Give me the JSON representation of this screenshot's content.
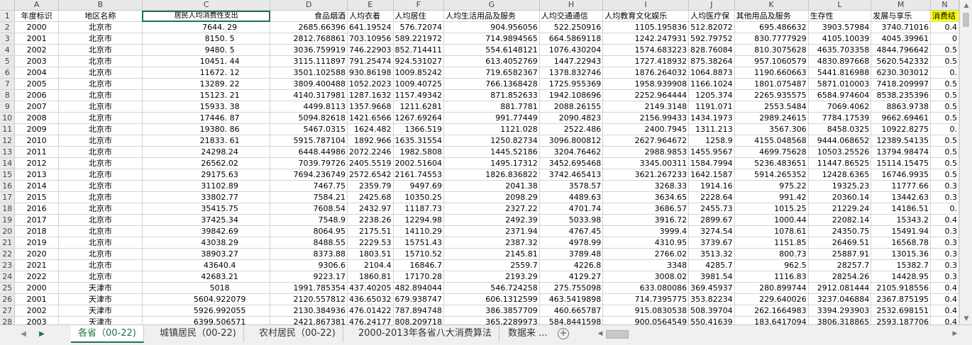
{
  "columns": [
    "A",
    "B",
    "C",
    "D",
    "E",
    "F",
    "G",
    "H",
    "I",
    "J",
    "K",
    "L",
    "M",
    "N"
  ],
  "header_row": [
    "年度标识",
    "地区名称",
    "居民人均消费性支出",
    "食品烟酒",
    "人均衣着",
    "人均居住",
    "人均生活用品及服务",
    "人均交通通信",
    "人均教育文化娱乐",
    "人均医疗保",
    "其他用品及服务",
    "生存性",
    "发展与享乐",
    "消费结"
  ],
  "rows": [
    [
      "2000",
      "北京市",
      "7644. 29",
      "2685.66396",
      "641.19524",
      "576.72074",
      "904.956056",
      "522.250916",
      "1105.195836",
      "512.82072",
      "695.486632",
      "3903.57984",
      "3740.71016",
      "0.4"
    ],
    [
      "2001",
      "北京市",
      "8150. 5",
      "2812.768861",
      "703.10956",
      "589.221972",
      "714.9894565",
      "664.5869118",
      "1242.247931",
      "592.79752",
      "830.7777929",
      "4105.10039",
      "4045.39961",
      "0"
    ],
    [
      "2002",
      "北京市",
      "9480. 5",
      "3036.759919",
      "746.22903",
      "852.714411",
      "554.6148121",
      "1076.430204",
      "1574.683223",
      "828.76084",
      "810.3075628",
      "4635.703358",
      "4844.796642",
      "0.5"
    ],
    [
      "2003",
      "北京市",
      "10451. 44",
      "3115.111897",
      "791.25474",
      "924.531027",
      "613.4052769",
      "1447.22943",
      "1727.418932",
      "875.38264",
      "957.1060579",
      "4830.897668",
      "5620.542332",
      "0.5"
    ],
    [
      "2004",
      "北京市",
      "11672. 12",
      "3501.102588",
      "930.86198",
      "1009.85242",
      "719.6582367",
      "1378.832746",
      "1876.264032",
      "1064.8873",
      "1190.660663",
      "5441.816988",
      "6230.303012",
      "0."
    ],
    [
      "2005",
      "北京市",
      "13289. 22",
      "3809.400488",
      "1052.2023",
      "1009.40725",
      "766.1368428",
      "1725.955369",
      "1958.939908",
      "1166.1024",
      "1801.075487",
      "5871.010003",
      "7418.209997",
      "0.5"
    ],
    [
      "2006",
      "北京市",
      "15123. 21",
      "4140.317981",
      "1287.1632",
      "1157.49342",
      "871.852633",
      "1942.108696",
      "2252.964444",
      "1205.374",
      "2265.935575",
      "6584.974604",
      "8538.235396",
      "0.5"
    ],
    [
      "2007",
      "北京市",
      "15933. 38",
      "4499.8113",
      "1357.9668",
      "1211.6281",
      "881.7781",
      "2088.26155",
      "2149.3148",
      "1191.071",
      "2553.5484",
      "7069.4062",
      "8863.9738",
      "0.5"
    ],
    [
      "2008",
      "北京市",
      "17446. 87",
      "5094.82618",
      "1421.6566",
      "1267.69264",
      "991.77449",
      "2090.4823",
      "2156.99433",
      "1434.1973",
      "2989.24615",
      "7784.17539",
      "9662.69461",
      "0.5"
    ],
    [
      "2009",
      "北京市",
      "19380. 86",
      "5467.0315",
      "1624.482",
      "1366.519",
      "1121.028",
      "2522.486",
      "2400.7945",
      "1311.213",
      "3567.306",
      "8458.0325",
      "10922.8275",
      "0."
    ],
    [
      "2010",
      "北京市",
      "21833. 61",
      "5915.787104",
      "1892.966",
      "1635.31554",
      "1250.82734",
      "3096.800812",
      "2627.964672",
      "1258.9",
      "4155.048568",
      "9444.068652",
      "12389.54135",
      "0.5"
    ],
    [
      "2011",
      "北京市",
      "24298.24",
      "6448.44986",
      "2072.2246",
      "1982.5808",
      "1445.52186",
      "3204.76462",
      "2988.9853",
      "1455.9567",
      "4699.75628",
      "10503.25526",
      "13794.98474",
      "0.5"
    ],
    [
      "2012",
      "北京市",
      "26562.02",
      "7039.79726",
      "2405.5519",
      "2002.51604",
      "1495.17312",
      "3452.695468",
      "3345.00311",
      "1584.7994",
      "5236.483651",
      "11447.86525",
      "15114.15475",
      "0.5"
    ],
    [
      "2013",
      "北京市",
      "29175.63",
      "7694.236749",
      "2572.6542",
      "2161.74553",
      "1826.836822",
      "3742.465413",
      "3621.267233",
      "1642.1587",
      "5914.265352",
      "12428.6365",
      "16746.9935",
      "0.5"
    ],
    [
      "2014",
      "北京市",
      "31102.89",
      "7467.75",
      "2359.79",
      "9497.69",
      "2041.38",
      "3578.57",
      "3268.33",
      "1914.16",
      "975.22",
      "19325.23",
      "11777.66",
      "0.3"
    ],
    [
      "2015",
      "北京市",
      "33802.77",
      "7584.21",
      "2425.68",
      "10350.25",
      "2098.29",
      "4489.63",
      "3634.65",
      "2228.64",
      "991.42",
      "20360.14",
      "13442.63",
      "0.3"
    ],
    [
      "2016",
      "北京市",
      "35415.75",
      "7608.54",
      "2432.97",
      "11187.73",
      "2327.22",
      "4701.74",
      "3686.57",
      "2455.73",
      "1015.25",
      "21229.24",
      "14186.51",
      "0."
    ],
    [
      "2017",
      "北京市",
      "37425.34",
      "7548.9",
      "2238.26",
      "12294.98",
      "2492.39",
      "5033.98",
      "3916.72",
      "2899.67",
      "1000.44",
      "22082.14",
      "15343.2",
      "0.4"
    ],
    [
      "2018",
      "北京市",
      "39842.69",
      "8064.95",
      "2175.51",
      "14110.29",
      "2371.94",
      "4767.45",
      "3999.4",
      "3274.54",
      "1078.61",
      "24350.75",
      "15491.94",
      "0.3"
    ],
    [
      "2019",
      "北京市",
      "43038.29",
      "8488.55",
      "2229.53",
      "15751.43",
      "2387.32",
      "4978.99",
      "4310.95",
      "3739.67",
      "1151.85",
      "26469.51",
      "16568.78",
      "0.3"
    ],
    [
      "2020",
      "北京市",
      "38903.27",
      "8373.88",
      "1803.51",
      "15710.52",
      "2145.81",
      "3789.48",
      "2766.02",
      "3513.32",
      "800.73",
      "25887.91",
      "13015.36",
      "0.3"
    ],
    [
      "2021",
      "北京市",
      "43640.4",
      "9306.6",
      "2104.4",
      "16846.7",
      "2559.7",
      "4226.8",
      "3348",
      "4285.7",
      "962.5",
      "28257.7",
      "15382.7",
      "0.3"
    ],
    [
      "2022",
      "北京市",
      "42683.21",
      "9223.17",
      "1860.81",
      "17170.28",
      "2193.29",
      "4129.27",
      "3008.02",
      "3981.54",
      "1116.83",
      "28254.26",
      "14428.95",
      "0.3"
    ],
    [
      "2000",
      "天津市",
      "5018",
      "1991.785354",
      "437.40205",
      "482.894044",
      "546.724258",
      "275.755098",
      "633.080086",
      "369.45937",
      "280.899744",
      "2912.081444",
      "2105.918556",
      "0.4"
    ],
    [
      "2001",
      "天津市",
      "5604.922079",
      "2120.557812",
      "436.65032",
      "679.938747",
      "606.1312599",
      "463.5419898",
      "714.7395775",
      "353.82234",
      "229.640026",
      "3237.046884",
      "2367.875195",
      "0.4"
    ],
    [
      "2002",
      "天津市",
      "5926.992055",
      "2130.384936",
      "476.01422",
      "787.894748",
      "386.3857709",
      "460.665787",
      "915.0830538",
      "508.39704",
      "262.1664983",
      "3394.293903",
      "2532.698151",
      "0.4"
    ],
    [
      "2003",
      "天津市",
      "6399.506571",
      "2421.867381",
      "476.24177",
      "808.209718",
      "365.2289973",
      "584.8441598",
      "900.0564549",
      "550.41639",
      "183.6417094",
      "3806.318865",
      "2593.187706",
      "0.4"
    ]
  ],
  "row_numbers": [
    "1",
    "2",
    "3",
    "4",
    "5",
    "6",
    "7",
    "8",
    "9",
    "10",
    "11",
    "12",
    "13",
    "14",
    "15",
    "16",
    "17",
    "18",
    "19",
    "20",
    "21",
    "22",
    "23",
    "24",
    "25",
    "26",
    "27",
    "28"
  ],
  "tabs": [
    {
      "label": "各省（00-22)",
      "active": true
    },
    {
      "label": "城镇居民（00-22)",
      "active": false
    },
    {
      "label": "农村居民（00-22)",
      "active": false
    },
    {
      "label": "2000-2013年各省八大消费算法",
      "active": false
    },
    {
      "label": "数据来 ...",
      "active": false
    }
  ],
  "highlight_color": "#ffff00",
  "accent_color": "#217346"
}
